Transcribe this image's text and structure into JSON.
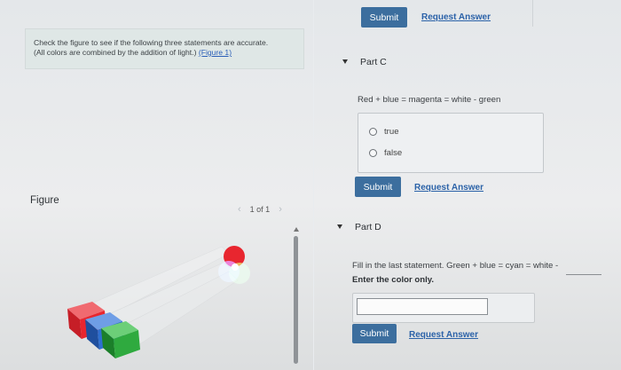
{
  "left": {
    "info_text_line1": "Check the figure to see if the following three statements are accurate.",
    "info_text_line2": "(All colors are combined by the addition of light.)",
    "figure_link": "(Figure 1)",
    "figure_heading": "Figure",
    "pager": {
      "label": "1 of 1",
      "prev_icon": "chevron-left-icon",
      "next_icon": "chevron-right-icon"
    }
  },
  "top_actions": {
    "submit": "Submit",
    "request_answer": "Request Answer"
  },
  "part_c": {
    "title": "Part C",
    "statement": "Red + blue = magenta = white - green",
    "options": [
      "true",
      "false"
    ],
    "submit": "Submit",
    "request_answer": "Request Answer"
  },
  "part_d": {
    "title": "Part D",
    "statement": "Fill in the last statement. Green + blue = cyan = white -",
    "instruction": "Enter the color only.",
    "input_value": "",
    "submit": "Submit",
    "request_answer": "Request Answer"
  },
  "colors": {
    "button": "#3c6e9e",
    "link": "#2b62a8",
    "red_light": "#e8262f",
    "green_light": "#2faa3f",
    "blue_light": "#2e6fd0"
  }
}
